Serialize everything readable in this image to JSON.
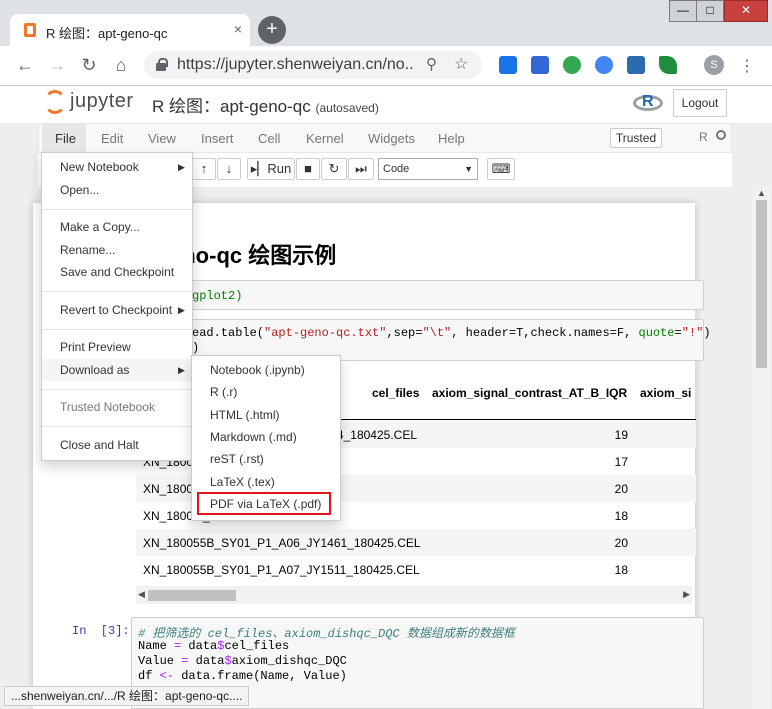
{
  "browser": {
    "tab_title": "R 绘图：apt-geno-qc",
    "tab_close": "×",
    "new_tab": "+",
    "url": "https://jupyter.shenweiyan.cn/no...",
    "avatar_letter": "S",
    "win_minimize": "—",
    "win_maximize": "□",
    "win_close": "✕",
    "status_url": "...shenweiyan.cn/.../R 绘图：apt-geno-qc...."
  },
  "jupyter": {
    "logo": "jupyter",
    "notebook_title": "R 绘图：apt-geno-qc",
    "autosaved": "(autosaved)",
    "logout": "Logout",
    "trusted": "Trusted",
    "kernel_name": "R",
    "menu": [
      "File",
      "Edit",
      "View",
      "Insert",
      "Cell",
      "Kernel",
      "Widgets",
      "Help"
    ],
    "toolbar": {
      "up": "↑",
      "down": "↓",
      "run": "Run",
      "cell_type": "Code",
      "keyboard": "⌨"
    }
  },
  "notebook": {
    "heading": "eno-qc 绘图示例",
    "cell1_code": "gplot2)",
    "cell2_line1_a": "ead.table(",
    "cell2_line1_str": "\"apt-geno-qc.txt\"",
    "cell2_line1_b": ",sep=",
    "cell2_line1_sep": "\"\\t\"",
    "cell2_line1_c": ", header=T,check.names=F, ",
    "cell2_line1_q": "quote",
    "cell2_line1_d": "=",
    "cell2_line1_qv": "\"!\"",
    "cell2_line1_e": ")",
    "cell2_line2": ")",
    "table": {
      "headers": [
        "cel_files",
        "axiom_signal_contrast_AT_B_IQR",
        "axiom_si"
      ],
      "rows": [
        {
          "cel": "4_180425.CEL",
          "val": "19"
        },
        {
          "cel": "XN_1800          6_180425.CEL",
          "val": "17"
        },
        {
          "cel": "XN_1800          2_180425.CEL",
          "val": "20"
        },
        {
          "cel": "XN_1800          7_180425.CEL",
          "val": "18"
        },
        {
          "cel": "XN_180055B_SY01_P1_A06_JY1461_180425.CEL",
          "val": "20"
        },
        {
          "cel": "XN_180055B_SY01_P1_A07_JY1511_180425.CEL",
          "val": "18"
        }
      ]
    },
    "cell3_prompt": "In  [3]:",
    "cell3_comment": "# 把筛选的 cel_files、axiom_dishqc_DQC 数据组成新的数据框",
    "cell3_l2_a": "Name ",
    "cell3_l2_b": "= ",
    "cell3_l2_c": "data",
    "cell3_l2_d": "$",
    "cell3_l2_e": "cel_files",
    "cell3_l3_a": "Value ",
    "cell3_l3_b": "= ",
    "cell3_l3_c": "data",
    "cell3_l3_d": "$",
    "cell3_l3_e": "axiom_dishqc_DQC",
    "cell3_l4_a": "df ",
    "cell3_l4_b": "<- ",
    "cell3_l4_c": "data.frame(Name, Value)"
  },
  "file_menu": {
    "new_notebook": "New Notebook",
    "open": "Open...",
    "make_copy": "Make a Copy...",
    "rename": "Rename...",
    "save_checkpoint": "Save and Checkpoint",
    "revert": "Revert to Checkpoint",
    "print_preview": "Print Preview",
    "download_as": "Download as",
    "trusted_notebook": "Trusted Notebook",
    "close_halt": "Close and Halt"
  },
  "download_menu": [
    "Notebook (.ipynb)",
    "R (.r)",
    "HTML (.html)",
    "Markdown (.md)",
    "reST (.rst)",
    "LaTeX (.tex)",
    "PDF via LaTeX (.pdf)"
  ],
  "colors": {
    "jupyter_orange": "#f37726",
    "highlight_red": "#e0141b",
    "prompt_blue": "#303f9f"
  }
}
